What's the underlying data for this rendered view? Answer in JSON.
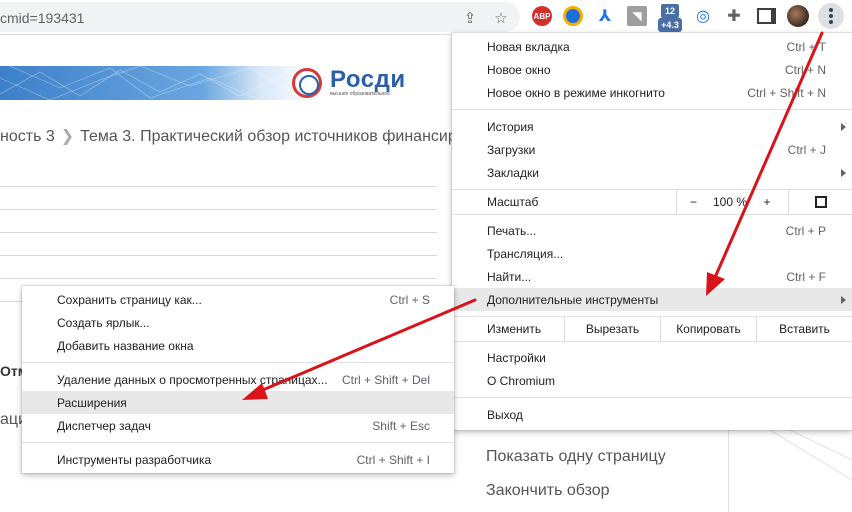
{
  "browser": {
    "url": "cmid=193431",
    "icons": [
      "share-icon",
      "bookmark-star-icon",
      "adblock-plus-icon",
      "ring-extension-icon",
      "acrobat-icon",
      "rss-icon",
      "counter-extension-icon",
      "swirl-extension-icon",
      "extensions-puzzle-icon",
      "side-panel-icon",
      "profile-avatar",
      "kebab-menu-icon"
    ],
    "abp_label": "ABP",
    "badge_count": "+4.3",
    "badge_top": "12"
  },
  "page": {
    "banner_text": "Росди",
    "banner_subtext": "высшее образовательное",
    "breadcrumb_part1": "ность 3",
    "breadcrumb_part2": "Тема 3. Практический обзор источников финансир",
    "left_fragment_bold": "Отм",
    "left_fragment": "ации",
    "show_one_page": "Показать одну страницу",
    "finish_review": "Закончить обзор"
  },
  "main_menu": {
    "new_tab": "Новая вкладка",
    "new_tab_sc": "Ctrl + T",
    "new_window": "Новое окно",
    "new_window_sc": "Ctrl + N",
    "incognito": "Новое окно в режиме инкогнито",
    "incognito_sc": "Ctrl + Shift + N",
    "history": "История",
    "downloads": "Загрузки",
    "downloads_sc": "Ctrl + J",
    "bookmarks": "Закладки",
    "zoom_label": "Масштаб",
    "zoom_minus": "−",
    "zoom_value": "100 %",
    "zoom_plus": "+",
    "print": "Печать...",
    "print_sc": "Ctrl + P",
    "cast": "Трансляция...",
    "find": "Найти...",
    "find_sc": "Ctrl + F",
    "more_tools": "Дополнительные инструменты",
    "edit": "Изменить",
    "cut": "Вырезать",
    "copy": "Копировать",
    "paste": "Вставить",
    "settings": "Настройки",
    "about": "О Chromium",
    "exit": "Выход"
  },
  "sub_menu": {
    "save_page": "Сохранить страницу как...",
    "save_page_sc": "Ctrl + S",
    "create_shortcut": "Создать ярлык...",
    "add_window_name": "Добавить название окна",
    "clear_data": "Удаление данных о просмотренных страницах...",
    "clear_data_sc": "Ctrl + Shift + Del",
    "extensions": "Расширения",
    "task_manager": "Диспетчер задач",
    "task_manager_sc": "Shift + Esc",
    "dev_tools": "Инструменты разработчика",
    "dev_tools_sc": "Ctrl + Shift + I"
  },
  "colors": {
    "annotation_arrow": "#d8141a",
    "highlight": "#e8e8e9",
    "banner_blue": "#2d5fa8"
  }
}
